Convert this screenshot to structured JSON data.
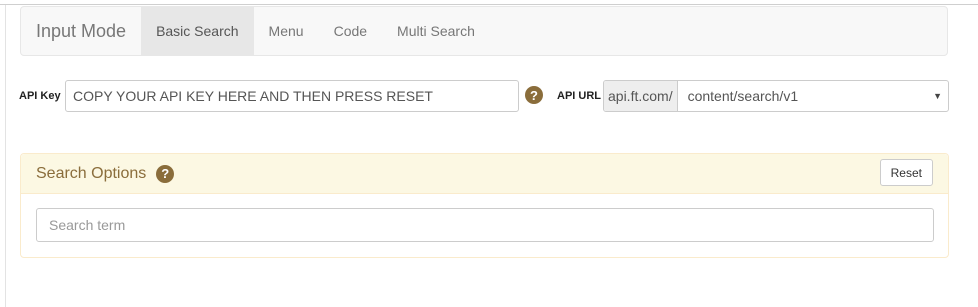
{
  "navbar": {
    "brand": "Input Mode",
    "items": [
      {
        "label": "Basic Search",
        "active": true
      },
      {
        "label": "Menu",
        "active": false
      },
      {
        "label": "Code",
        "active": false
      },
      {
        "label": "Multi Search",
        "active": false
      }
    ]
  },
  "api": {
    "key_label": "API Key",
    "key_value": "COPY YOUR API KEY HERE AND THEN PRESS RESET",
    "help_glyph": "?",
    "url_label": "API URL",
    "url_prefix": "api.ft.com/",
    "url_selected": "content/search/v1",
    "caret": "▼"
  },
  "search_options": {
    "title": "Search Options",
    "help_glyph": "?",
    "reset_label": "Reset",
    "search_placeholder": "Search term"
  },
  "colors": {
    "warning_text": "#8a6d3b",
    "warning_bg": "#fcf8e3",
    "warning_border": "#faebcc",
    "navbar_bg": "#f8f8f8",
    "navbar_active_bg": "#e7e7e7"
  }
}
